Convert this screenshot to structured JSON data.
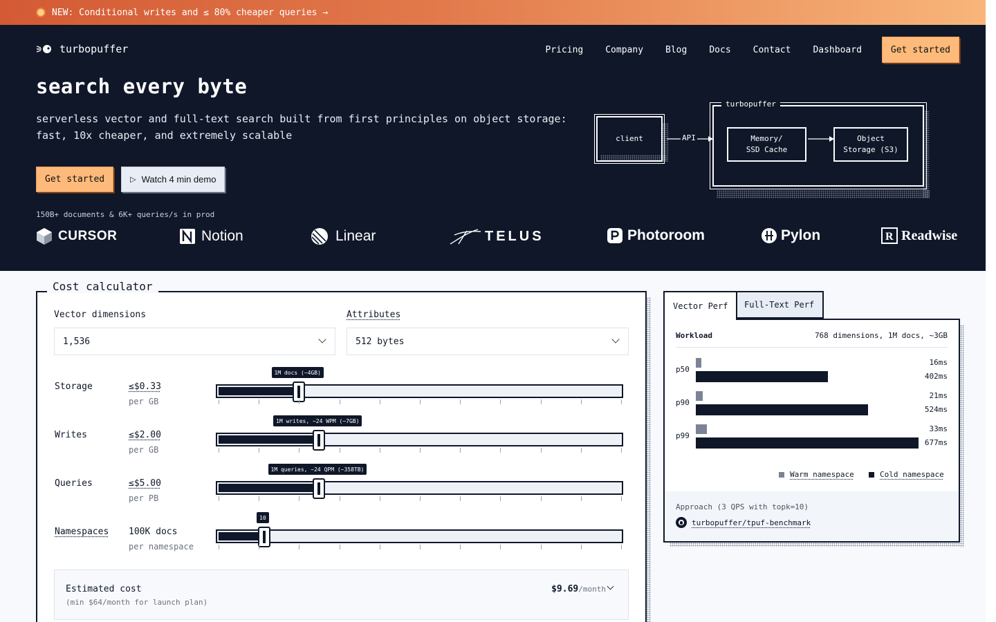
{
  "announcement": {
    "text": "NEW: Conditional writes and ≤ 80% cheaper queries →"
  },
  "header": {
    "brand": "turbopuffer",
    "nav": [
      "Pricing",
      "Company",
      "Blog",
      "Docs",
      "Contact",
      "Dashboard"
    ],
    "cta": "Get started"
  },
  "hero": {
    "title": "search every byte",
    "subtitle": "serverless vector and full-text search built from first principles on object storage: fast, 10x cheaper, and extremely scalable",
    "cta_primary": "Get started",
    "cta_secondary": "Watch 4 min demo",
    "stats": "150B+ documents & 6K+ queries/s in prod",
    "logos": [
      "CURSOR",
      "Notion",
      "Linear",
      "TELUS",
      "Photoroom",
      "Pylon",
      "Readwise"
    ]
  },
  "diagram": {
    "client": "client",
    "api": "API",
    "group": "turbopuffer",
    "cache_line1": "Memory/",
    "cache_line2": "SSD Cache",
    "storage_line1": "Object",
    "storage_line2": "Storage (S3)"
  },
  "calculator": {
    "title": "Cost calculator",
    "vector_label": "Vector dimensions",
    "vector_value": "1,536",
    "attr_label": "Attributes",
    "attr_value": "512 bytes",
    "rows": [
      {
        "label": "Storage",
        "price": "≤$0.33",
        "unit": "per GB",
        "tip": "1M docs (~4GB)",
        "value": 0.2
      },
      {
        "label": "Writes",
        "price": "≤$2.00",
        "unit": "per GB",
        "tip": "1M writes, ~24 WPM (~7GB)",
        "value": 0.25
      },
      {
        "label": "Queries",
        "price": "≤$5.00",
        "unit": "per PB",
        "tip": "1M queries, ~24 QPM (~358TB)",
        "value": 0.25
      },
      {
        "label": "Namespaces",
        "price": "100K docs",
        "unit": "per namespace",
        "tip": "10",
        "value": 0.115
      }
    ],
    "estimate_label": "Estimated cost",
    "estimate_note": "(min $64/month for launch plan)",
    "estimate_value": "$9.69",
    "estimate_unit": "/month"
  },
  "perf": {
    "tabs": [
      "Vector Perf",
      "Full-Text Perf"
    ],
    "workload_label": "Workload",
    "workload_value": "768 dimensions, 1M docs, ~3GB",
    "rows": [
      {
        "label": "p50",
        "warm": "16ms",
        "cold": "402ms",
        "warm_ms": 16,
        "cold_ms": 402
      },
      {
        "label": "p90",
        "warm": "21ms",
        "cold": "524ms",
        "warm_ms": 21,
        "cold_ms": 524
      },
      {
        "label": "p99",
        "warm": "33ms",
        "cold": "677ms",
        "warm_ms": 33,
        "cold_ms": 677
      }
    ],
    "legend_warm": "Warm namespace",
    "legend_cold": "Cold namespace",
    "approach": "Approach (3 QPS with topk=10)",
    "repo": "turbopuffer/tpuf-benchmark",
    "colors": {
      "warm": "#7b8496",
      "cold": "#0f1729"
    }
  }
}
